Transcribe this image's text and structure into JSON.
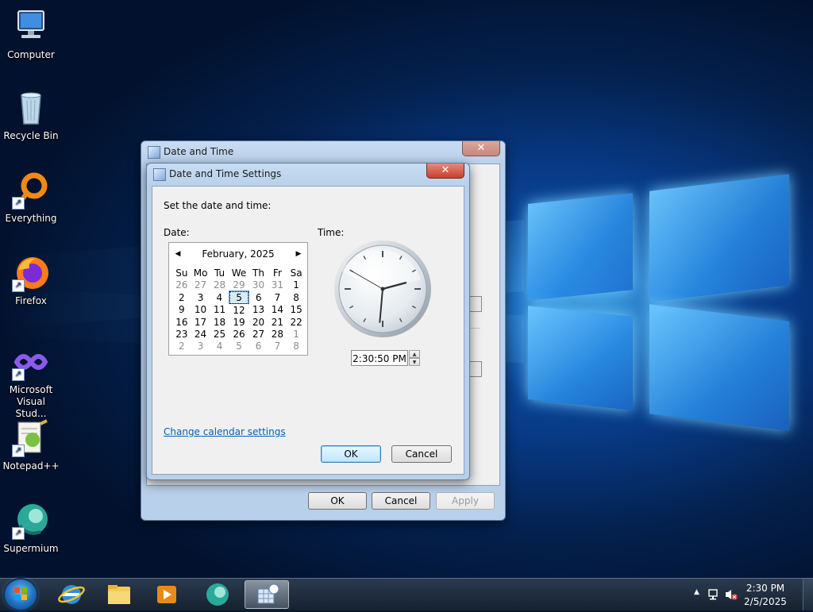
{
  "desktop": {
    "icons": [
      {
        "label": "Computer"
      },
      {
        "label": "Recycle Bin"
      },
      {
        "label": "Everything"
      },
      {
        "label": "Firefox"
      },
      {
        "label": "Microsoft Visual Stud..."
      },
      {
        "label": "Notepad++"
      },
      {
        "label": "Supermium"
      }
    ]
  },
  "outer_window": {
    "title": "Date and Time",
    "close_label": "✕",
    "buttons": {
      "ok": "OK",
      "cancel": "Cancel",
      "apply": "Apply"
    }
  },
  "dialog": {
    "title": "Date and Time Settings",
    "close_label": "✕",
    "heading": "Set the date and time:",
    "date_label": "Date:",
    "time_label": "Time:",
    "calendar": {
      "month": "February, 2025",
      "prev_arrow": "◀",
      "next_arrow": "▶",
      "weekdays": [
        "Su",
        "Mo",
        "Tu",
        "We",
        "Th",
        "Fr",
        "Sa"
      ],
      "weeks": [
        [
          "26",
          "27",
          "28",
          "29",
          "30",
          "31",
          "1"
        ],
        [
          "2",
          "3",
          "4",
          "5",
          "6",
          "7",
          "8"
        ],
        [
          "9",
          "10",
          "11",
          "12",
          "13",
          "14",
          "15"
        ],
        [
          "16",
          "17",
          "18",
          "19",
          "20",
          "21",
          "22"
        ],
        [
          "23",
          "24",
          "25",
          "26",
          "27",
          "28",
          "1"
        ],
        [
          "2",
          "3",
          "4",
          "5",
          "6",
          "7",
          "8"
        ]
      ],
      "selected_day": "5"
    },
    "clock": {
      "hours": 2,
      "minutes": 30,
      "seconds": 50
    },
    "time_value": "2:30:50 PM",
    "spin_up": "▲",
    "spin_down": "▼",
    "link": "Change calendar settings",
    "ok": "OK",
    "cancel": "Cancel"
  },
  "taskbar": {
    "time": "2:30 PM",
    "date": "2/5/2025",
    "tray_arrow": "▲"
  },
  "colors": {
    "accent": "#0b5fb4",
    "close_red": "#c8402c"
  }
}
